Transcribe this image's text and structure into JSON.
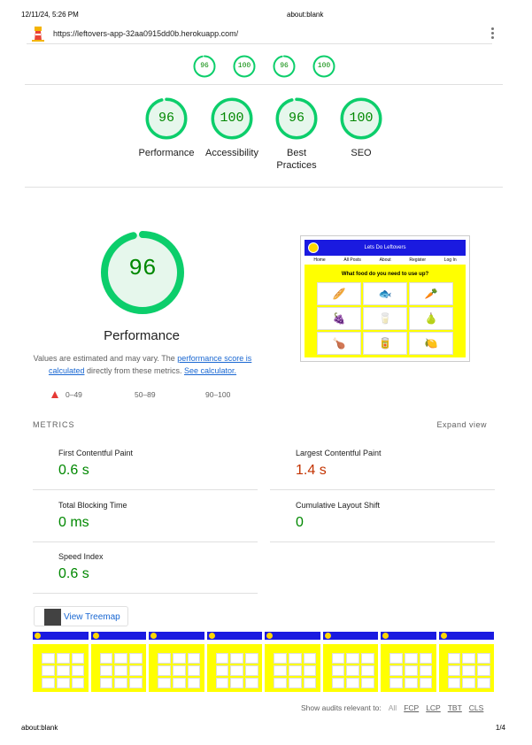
{
  "print_header": {
    "date": "12/11/24, 5:26 PM",
    "title": "about:blank"
  },
  "topbar": {
    "url": "https://leftovers-app-32aa0915dd0b.herokuapp.com/"
  },
  "colors": {
    "pass": "#0cce6b",
    "pass_text": "#008800",
    "average": "#c33300",
    "fail": "#e53935",
    "link": "#1967d2",
    "site_yellow": "#ffff00",
    "site_blue": "#1a1ae0"
  },
  "mini_gauges": [
    {
      "score": "96",
      "value": 0.96
    },
    {
      "score": "100",
      "value": 1.0
    },
    {
      "score": "96",
      "value": 0.96
    },
    {
      "score": "100",
      "value": 1.0
    }
  ],
  "categories": [
    {
      "score": "96",
      "value": 0.96,
      "label": "Performance"
    },
    {
      "score": "100",
      "value": 1.0,
      "label": "Accessibility"
    },
    {
      "score": "96",
      "value": 0.96,
      "label": "Best Practices"
    },
    {
      "score": "100",
      "value": 1.0,
      "label": "SEO"
    }
  ],
  "performance": {
    "score": "96",
    "value": 0.96,
    "title": "Performance",
    "disclaimer_pre": "Values are estimated and may vary. The ",
    "disclaimer_link": "performance score is calculated",
    "disclaimer_mid": " directly from these metrics. ",
    "calculator_link": "See calculator."
  },
  "legend": {
    "fail": "0–49",
    "average": "50–89",
    "pass": "90–100"
  },
  "screenshot": {
    "site_title": "Lets Do Leftovers",
    "nav": [
      "Home",
      "All Posts",
      "About",
      "Register",
      "Log In"
    ],
    "heading": "What food do you need to use up?"
  },
  "metrics": {
    "header": "METRICS",
    "expand": "Expand view",
    "items": [
      {
        "title": "First Contentful Paint",
        "value": "0.6 s",
        "status": "pass"
      },
      {
        "title": "Largest Contentful Paint",
        "value": "1.4 s",
        "status": "average"
      },
      {
        "title": "Total Blocking Time",
        "value": "0 ms",
        "status": "pass"
      },
      {
        "title": "Cumulative Layout Shift",
        "value": "0",
        "status": "pass"
      },
      {
        "title": "Speed Index",
        "value": "0.6 s",
        "status": "pass"
      }
    ]
  },
  "treemap": {
    "label": "View Treemap"
  },
  "filmstrip_frames": 8,
  "audits": {
    "label": "Show audits relevant to:",
    "filters": [
      "All",
      "FCP",
      "LCP",
      "TBT",
      "CLS"
    ]
  },
  "print_footer": {
    "title": "about:blank",
    "page": "1/4"
  }
}
